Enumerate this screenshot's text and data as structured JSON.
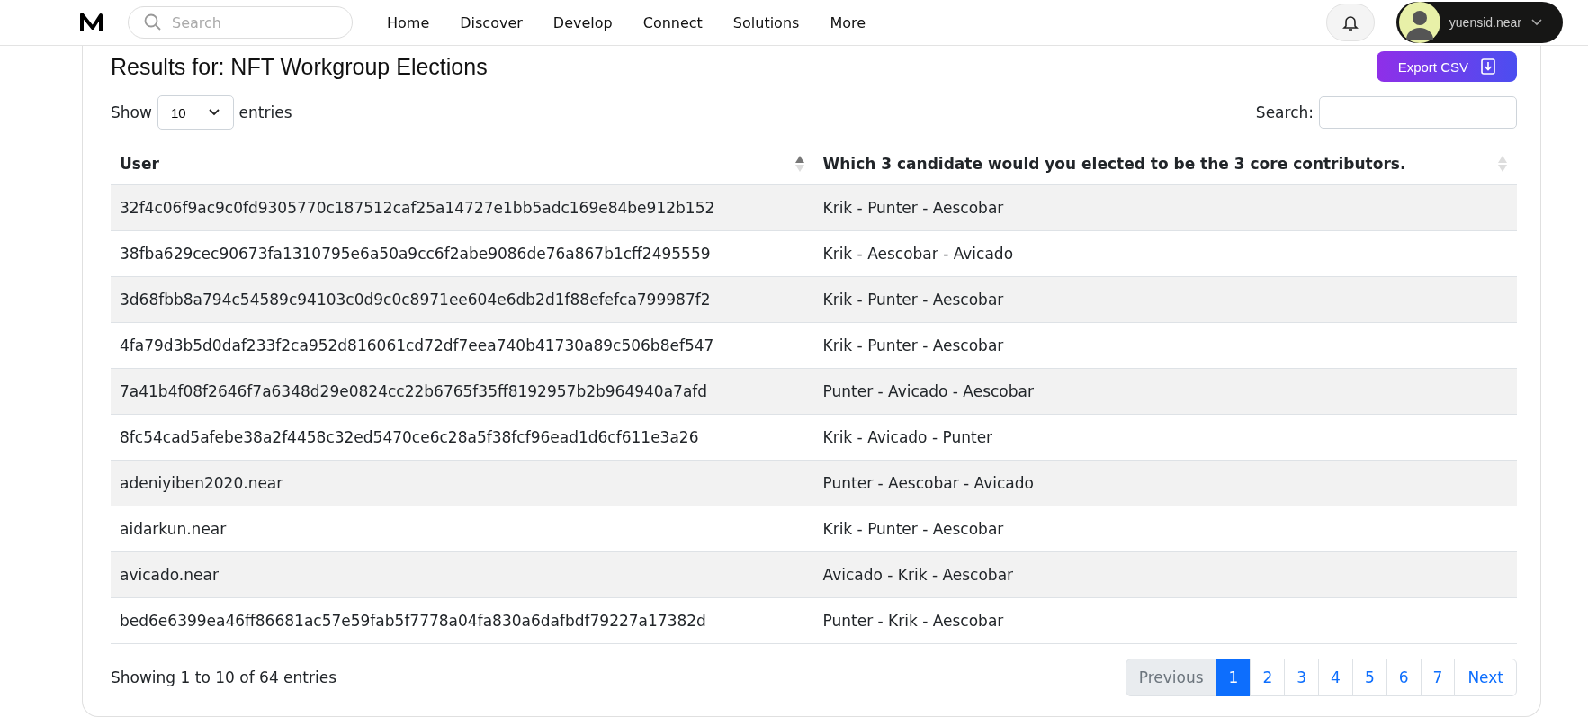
{
  "nav": {
    "search": {
      "placeholder": "Search"
    },
    "links": [
      "Home",
      "Discover",
      "Develop",
      "Connect",
      "Solutions",
      "More"
    ],
    "user": "yuensid.near"
  },
  "page": {
    "title": "Results for: NFT Workgroup Elections",
    "export_button": "Export CSV",
    "length": {
      "label_before": "Show",
      "value": "10",
      "label_after": "entries"
    },
    "search": {
      "label": "Search:"
    },
    "table": {
      "columns": [
        {
          "label": "User",
          "sorted": true
        },
        {
          "label": "Which 3 candidate would you elected to be the 3 core contributors.",
          "sorted": false
        }
      ],
      "rows": [
        [
          "32f4c06f9ac9c0fd9305770c187512caf25a14727e1bb5adc169e84be912b152",
          "Krik - Punter - Aescobar"
        ],
        [
          "38fba629cec90673fa1310795e6a50a9cc6f2abe9086de76a867b1cff2495559",
          "Krik - Aescobar - Avicado"
        ],
        [
          "3d68fbb8a794c54589c94103c0d9c0c8971ee604e6db2d1f88efefca799987f2",
          "Krik - Punter - Aescobar"
        ],
        [
          "4fa79d3b5d0daf233f2ca952d816061cd72df7eea740b41730a89c506b8ef547",
          "Krik - Punter - Aescobar"
        ],
        [
          "7a41b4f08f2646f7a6348d29e0824cc22b6765f35ff8192957b2b964940a7afd",
          "Punter - Avicado - Aescobar"
        ],
        [
          "8fc54cad5afebe38a2f4458c32ed5470ce6c28a5f38fcf96ead1d6cf611e3a26",
          "Krik - Avicado - Punter"
        ],
        [
          "adeniyiben2020.near",
          "Punter - Aescobar - Avicado"
        ],
        [
          "aidarkun.near",
          "Krik - Punter - Aescobar"
        ],
        [
          "avicado.near",
          "Avicado - Krik - Aescobar"
        ],
        [
          "bed6e6399ea46ff86681ac57e59fab5f7778a04fa830a6dafbdf79227a17382d",
          "Punter - Krik - Aescobar"
        ]
      ]
    },
    "info": "Showing 1 to 10 of 64 entries",
    "pagination": [
      {
        "label": "Previous",
        "kind": "prev",
        "disabled": true,
        "selected": false
      },
      {
        "label": "1",
        "kind": "page",
        "disabled": false,
        "selected": true
      },
      {
        "label": "2",
        "kind": "page",
        "disabled": false,
        "selected": false
      },
      {
        "label": "3",
        "kind": "page",
        "disabled": false,
        "selected": false
      },
      {
        "label": "4",
        "kind": "page",
        "disabled": false,
        "selected": false
      },
      {
        "label": "5",
        "kind": "page",
        "disabled": false,
        "selected": false
      },
      {
        "label": "6",
        "kind": "page",
        "disabled": false,
        "selected": false
      },
      {
        "label": "7",
        "kind": "page",
        "disabled": false,
        "selected": false
      },
      {
        "label": "Next",
        "kind": "next",
        "disabled": false,
        "selected": false
      }
    ]
  }
}
